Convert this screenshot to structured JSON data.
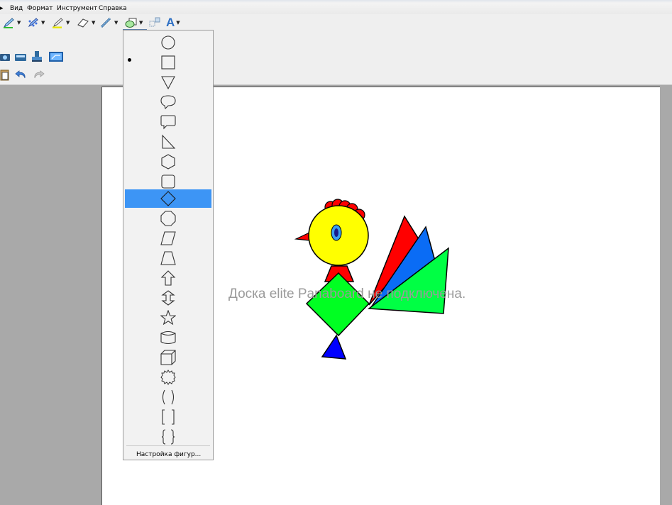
{
  "menu": {
    "items": [
      "Вид",
      "Формат",
      "Инструмент",
      "Справка"
    ]
  },
  "toolbar": {
    "text_tool_label": "A",
    "selected_tool": "shapes"
  },
  "shape_menu": {
    "shapes": [
      "circle",
      "square",
      "triangle-down",
      "oval-callout",
      "rect-callout",
      "right-triangle",
      "hexagon",
      "rounded-square",
      "diamond",
      "octagon",
      "parallelogram",
      "trapezoid",
      "up-arrow",
      "double-arrow",
      "star",
      "cylinder",
      "cube",
      "seal",
      "parentheses",
      "brackets",
      "braces"
    ],
    "active_index": 8,
    "settings_label": "Настройка фигур..."
  },
  "canvas": {
    "status_message": "Доска elite Panaboard не подключена."
  },
  "colors": {
    "menu_highlight": "#3d95f5",
    "rooster_head": "#ffff00",
    "rooster_comb": "#ff0000",
    "rooster_body": "#00ff22",
    "rooster_leg": "#0000ff",
    "tail_red": "#ff0000",
    "tail_blue": "#0a6cf5",
    "tail_green": "#00ff44"
  }
}
